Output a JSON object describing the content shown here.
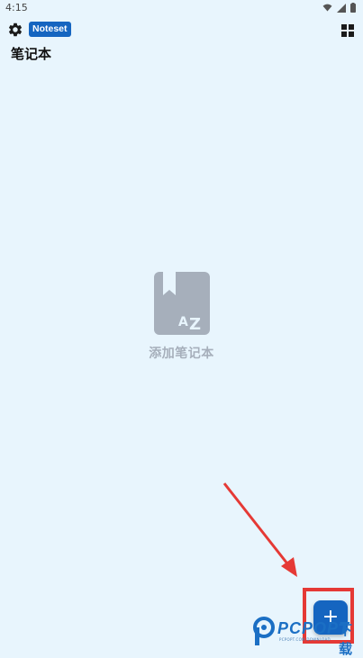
{
  "status_bar": {
    "time": "4:15",
    "icons": [
      "wifi-icon",
      "signal-icon",
      "battery-icon"
    ]
  },
  "header": {
    "settings_icon": "gear-icon",
    "app_badge": "Noteset",
    "layout_icon": "grid-view-icon",
    "title": "笔记本"
  },
  "empty_state": {
    "icon": "notebook-az-icon",
    "label": "添加笔记本"
  },
  "fab": {
    "label": "+",
    "icon": "plus-icon"
  },
  "annotation": {
    "arrow_color": "#e53935",
    "box_color": "#e53935"
  },
  "watermark": {
    "brand": "PCPOPT",
    "suffix": "下载",
    "subtitle": "PCPOPT.COM DOWNLOAD"
  },
  "colors": {
    "background": "#e8f5fd",
    "accent": "#1565c0",
    "empty_gray": "#a6afbb"
  }
}
